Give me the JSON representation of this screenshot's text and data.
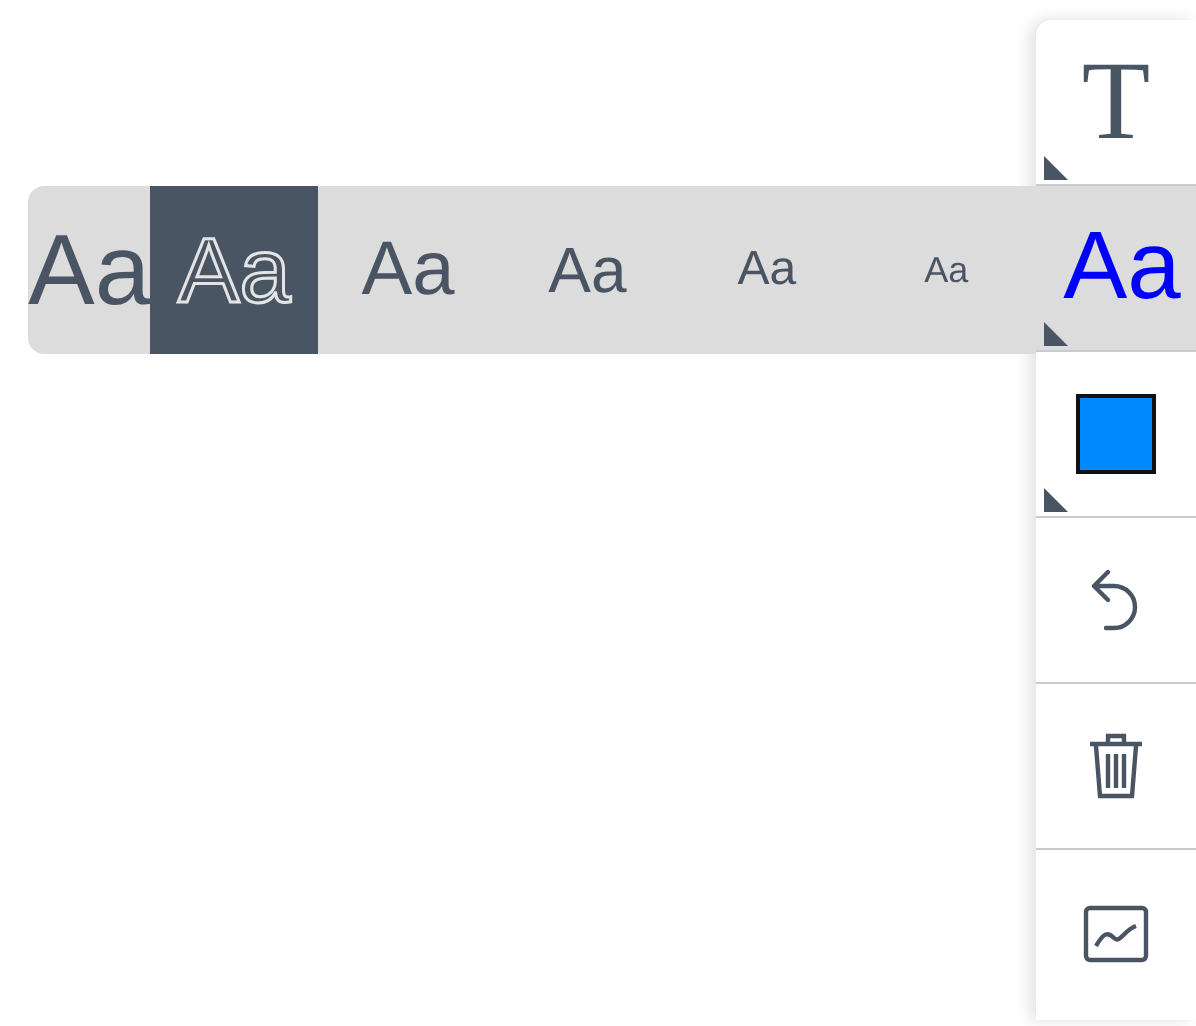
{
  "tools": [
    {
      "kind": "text",
      "label": "T",
      "selected": false,
      "has_menu": true
    },
    {
      "kind": "size",
      "label": "Aa",
      "selected": true,
      "has_menu": true,
      "color": "#0000ff",
      "options": [
        {
          "label": "Aa",
          "selected": false
        },
        {
          "label": "Aa",
          "selected": true
        },
        {
          "label": "Aa",
          "selected": false
        },
        {
          "label": "Aa",
          "selected": false
        },
        {
          "label": "Aa",
          "selected": false
        },
        {
          "label": "Aa",
          "selected": false
        }
      ]
    },
    {
      "kind": "color",
      "selected": false,
      "has_menu": true,
      "color": "#0088ff"
    },
    {
      "kind": "undo",
      "selected": false,
      "has_menu": false
    },
    {
      "kind": "delete",
      "selected": false,
      "has_menu": false
    },
    {
      "kind": "chart",
      "selected": false,
      "has_menu": false
    }
  ]
}
